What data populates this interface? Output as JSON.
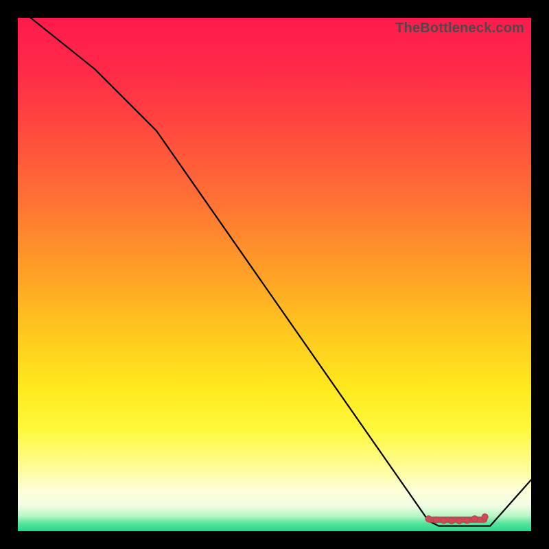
{
  "watermark": "TheBottleneck.com",
  "colors": {
    "curve": "#000000",
    "marker": "#cc4b57",
    "gradient_top": "#ff1a4d",
    "gradient_bottom": "#25d98b"
  },
  "chart_data": {
    "type": "line",
    "title": "",
    "xlabel": "",
    "ylabel": "",
    "xlim": [
      0,
      100
    ],
    "ylim": [
      0,
      100
    ],
    "grid": false,
    "legend": false,
    "series": [
      {
        "name": "bottleneck-curve",
        "points": [
          {
            "x": 0,
            "y": 102
          },
          {
            "x": 15,
            "y": 90
          },
          {
            "x": 27,
            "y": 78
          },
          {
            "x": 80,
            "y": 2
          },
          {
            "x": 82,
            "y": 1
          },
          {
            "x": 92,
            "y": 1
          },
          {
            "x": 100,
            "y": 10
          }
        ]
      }
    ],
    "markers": {
      "name": "highlight-range",
      "style": "dots-with-bar",
      "points": [
        {
          "x": 80,
          "y": 2.4
        },
        {
          "x": 81.5,
          "y": 2.2
        },
        {
          "x": 83,
          "y": 2.1
        },
        {
          "x": 84.5,
          "y": 2.0
        },
        {
          "x": 86,
          "y": 2.0
        },
        {
          "x": 87.5,
          "y": 2.1
        },
        {
          "x": 89,
          "y": 2.4
        },
        {
          "x": 91,
          "y": 2.8
        }
      ]
    }
  }
}
